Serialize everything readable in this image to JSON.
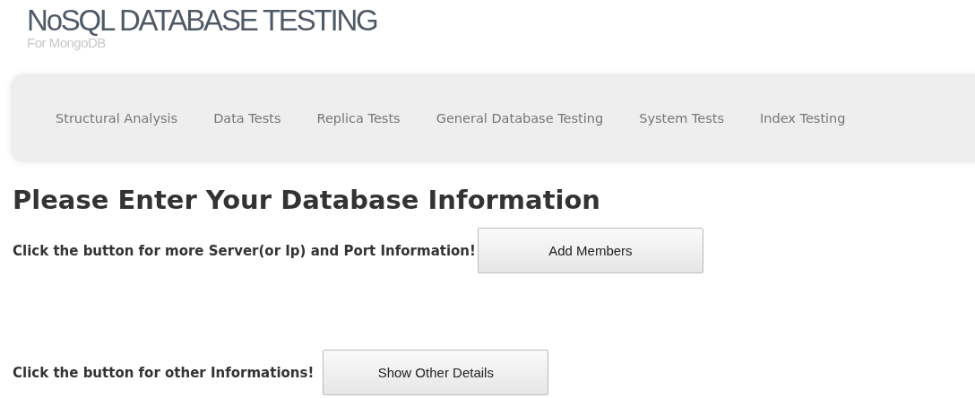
{
  "header": {
    "title": "NoSQL DATABASE TESTING",
    "subtitle": "For MongoDB"
  },
  "nav": [
    "Structural Analysis",
    "Data Tests",
    "Replica Tests",
    "General Database Testing",
    "System Tests",
    "Index Testing"
  ],
  "heading": "Please Enter Your Database Information",
  "rows": [
    {
      "text": "Click the button for more Server(or Ip) and Port Information!",
      "button": "Add Members"
    },
    {
      "text": "Click the button for other Informations!",
      "button": "Show Other Details"
    }
  ]
}
